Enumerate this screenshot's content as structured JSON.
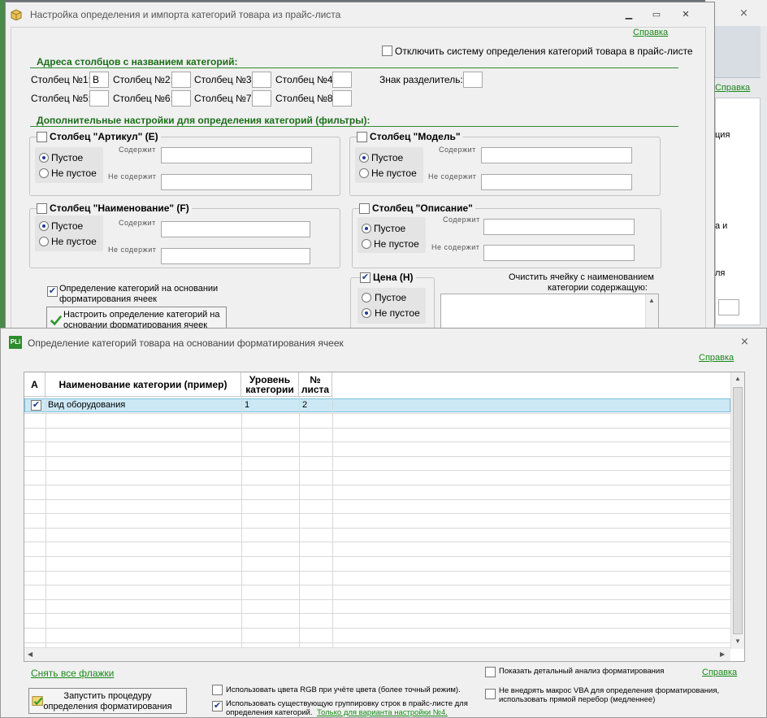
{
  "bg_window": {
    "partial_texts": [
      "ция",
      "а и",
      "ля"
    ],
    "link": "Справка"
  },
  "main_window": {
    "title": "Настройка определения и импорта категорий товара из прайс-листа",
    "help": "Справка",
    "disable_system_label": "Отключить систему определения категорий товара в прайс-листе",
    "columns_section": "Адреса столбцов с названием категорий:",
    "col1_label": "Столбец №1:",
    "col1_value": "B",
    "col2_label": "Столбец №2:",
    "col3_label": "Столбец №3:",
    "col4_label": "Столбец №4:",
    "col5_label": "Столбец №5:",
    "col6_label": "Столбец №6:",
    "col7_label": "Столбец №7:",
    "col8_label": "Столбец №8:",
    "separator_label": "Знак разделитель:",
    "filters_section": "Дополнительные настройки для определения категорий (фильтры):",
    "article_group": "Столбец \"Артикул\" (E)",
    "model_group": "Столбец \"Модель\"",
    "name_group": "Столбец \"Наименование\" (F)",
    "desc_group": "Столбец \"Описание\"",
    "price_group": "Цена (H)",
    "empty": "Пустое",
    "not_empty": "Не пустое",
    "contains": "Содержит",
    "not_contains": "Не содержит",
    "format_def_line1": "Определение категорий на основании",
    "format_def_line2": "форматирования ячеек",
    "configure_line1": "Настроить определение категорий на",
    "configure_line2": "основании форматирования ячеек",
    "clear_cell_line1": "Очистить ячейку с наименованием",
    "clear_cell_line2": "категории содержащую:"
  },
  "dialog": {
    "title": "Определение категорий товара на основании форматирования ячеек",
    "help": "Справка",
    "icon_text": "PLi",
    "headers": {
      "a": "A",
      "name": "Наименование категории (пример)",
      "level_line1": "Уровень",
      "level_line2": "категории",
      "sheet_line1": "№",
      "sheet_line2": "листа"
    },
    "rows": [
      {
        "name": "Вид оборудования",
        "level": "1",
        "sheet": "2"
      }
    ],
    "uncheck_all": "Снять все флажки",
    "run_line1": "Запустить процедуру",
    "run_line2": "определения форматирования",
    "rgb_label": "Использовать цвета RGB при учёте цвета (более точный режим).",
    "grouping_line1": "Использовать существующую группировку строк в прайс-листе для",
    "grouping_line2": "определения категорий.",
    "grouping_link": "Только для варианта настройки №4.",
    "detail_label": "Показать детальный анализ форматирования",
    "help2": "Справка",
    "novba_line1": "Не внедрять макрос VBA для определения форматирования,",
    "novba_line2": "использовать прямой перебор (медленнее)"
  },
  "colors": {
    "accent_green": "#1a8a1a",
    "check_blue": "#1c3d8c",
    "selected_row": "#cce8f4"
  }
}
